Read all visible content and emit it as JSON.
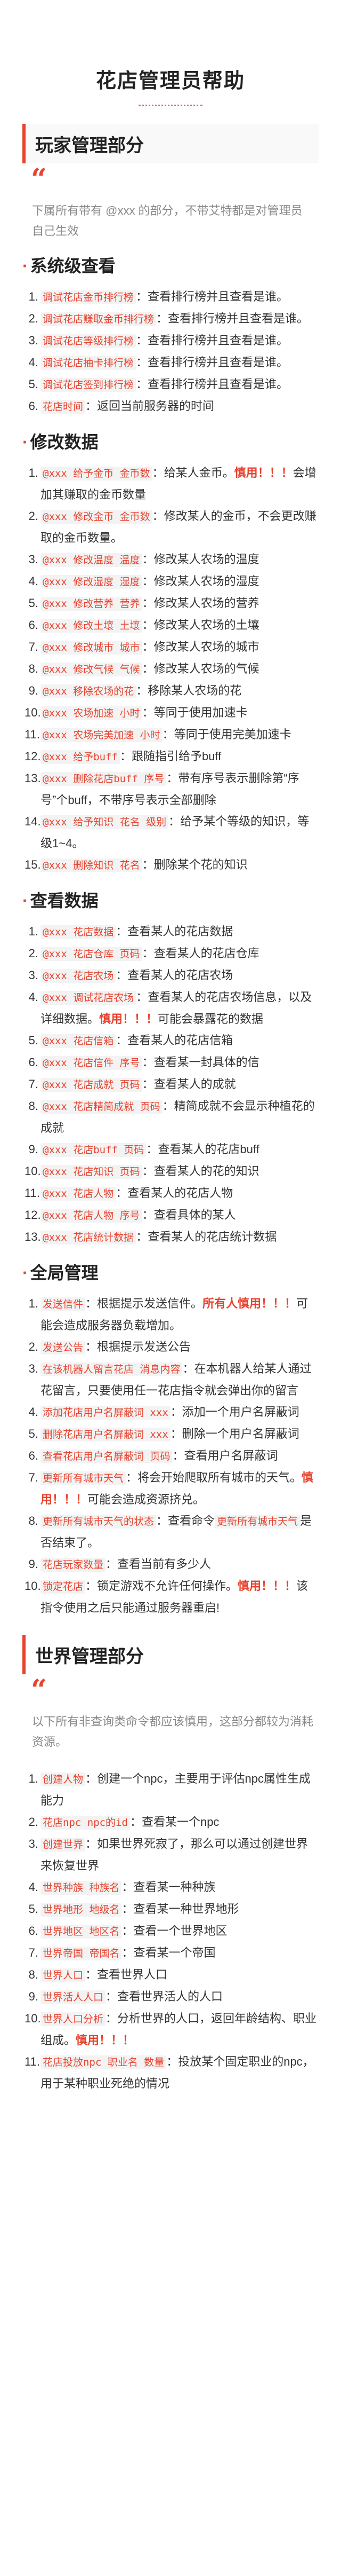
{
  "page_title": "花店管理员帮助",
  "colors": {
    "accent": "#e8432f",
    "text": "#333333",
    "muted": "#888888"
  },
  "sections": [
    {
      "id": "player",
      "title": "玩家管理部分",
      "quote": "下属所有带有 @xxx 的部分，不带艾特都是对管理员自己生效",
      "groups": [
        {
          "heading": "系统级查看",
          "items": [
            [
              [
                "c",
                "调试花店金币排行榜"
              ],
              [
                "t",
                "：查看排行榜并且查看是谁。"
              ]
            ],
            [
              [
                "c",
                "调试花店赚取金币排行榜"
              ],
              [
                "t",
                "：查看排行榜并且查看是谁。"
              ]
            ],
            [
              [
                "c",
                "调试花店等级排行榜"
              ],
              [
                "t",
                "：查看排行榜并且查看是谁。"
              ]
            ],
            [
              [
                "c",
                "调试花店抽卡排行榜"
              ],
              [
                "t",
                "：查看排行榜并且查看是谁。"
              ]
            ],
            [
              [
                "c",
                "调试花店签到排行榜"
              ],
              [
                "t",
                "：查看排行榜并且查看是谁。"
              ]
            ],
            [
              [
                "c",
                "花店时间"
              ],
              [
                "t",
                "：返回当前服务器的时间"
              ]
            ]
          ]
        },
        {
          "heading": "修改数据",
          "items": [
            [
              [
                "c",
                "@xxx 给予金币 金币数"
              ],
              [
                "t",
                "：给某人金币。"
              ],
              [
                "w",
                "慎用！！！"
              ],
              [
                "t",
                "会增加其赚取的金币数量"
              ]
            ],
            [
              [
                "c",
                "@xxx 修改金币 金币数"
              ],
              [
                "t",
                "：修改某人的金币，不会更改赚取的金币数量。"
              ]
            ],
            [
              [
                "c",
                "@xxx 修改温度 温度"
              ],
              [
                "t",
                "：修改某人农场的温度"
              ]
            ],
            [
              [
                "c",
                "@xxx 修改湿度 湿度"
              ],
              [
                "t",
                "：修改某人农场的湿度"
              ]
            ],
            [
              [
                "c",
                "@xxx 修改营养 营养"
              ],
              [
                "t",
                "：修改某人农场的营养"
              ]
            ],
            [
              [
                "c",
                "@xxx 修改土壤 土壤"
              ],
              [
                "t",
                "：修改某人农场的土壤"
              ]
            ],
            [
              [
                "c",
                "@xxx 修改城市 城市"
              ],
              [
                "t",
                "：修改某人农场的城市"
              ]
            ],
            [
              [
                "c",
                "@xxx 修改气候 气候"
              ],
              [
                "t",
                "：修改某人农场的气候"
              ]
            ],
            [
              [
                "c",
                "@xxx 移除农场的花"
              ],
              [
                "t",
                "：移除某人农场的花"
              ]
            ],
            [
              [
                "c",
                "@xxx 农场加速 小时"
              ],
              [
                "t",
                "：等同于使用加速卡"
              ]
            ],
            [
              [
                "c",
                "@xxx 农场完美加速 小时"
              ],
              [
                "t",
                "：等同于使用完美加速卡"
              ]
            ],
            [
              [
                "c",
                "@xxx 给予buff"
              ],
              [
                "t",
                "：跟随指引给予buff"
              ]
            ],
            [
              [
                "c",
                "@xxx 删除花店buff 序号"
              ],
              [
                "t",
                "：带有序号表示删除第“序号”个buff，不带序号表示全部删除"
              ]
            ],
            [
              [
                "c",
                "@xxx 给予知识 花名 级别"
              ],
              [
                "t",
                "：给予某个等级的知识，等级1~4。"
              ]
            ],
            [
              [
                "c",
                "@xxx 删除知识 花名"
              ],
              [
                "t",
                "：删除某个花的知识"
              ]
            ]
          ]
        },
        {
          "heading": "查看数据",
          "items": [
            [
              [
                "c",
                "@xxx 花店数据"
              ],
              [
                "t",
                "：查看某人的花店数据"
              ]
            ],
            [
              [
                "c",
                "@xxx 花店仓库 页码"
              ],
              [
                "t",
                "：查看某人的花店仓库"
              ]
            ],
            [
              [
                "c",
                "@xxx 花店农场"
              ],
              [
                "t",
                "：查看某人的花店农场"
              ]
            ],
            [
              [
                "c",
                "@xxx 调试花店农场"
              ],
              [
                "t",
                "：查看某人的花店农场信息，以及详细数据。"
              ],
              [
                "w",
                "慎用！！！"
              ],
              [
                "t",
                "可能会暴露花的数据"
              ]
            ],
            [
              [
                "c",
                "@xxx 花店信箱"
              ],
              [
                "t",
                "：查看某人的花店信箱"
              ]
            ],
            [
              [
                "c",
                "@xxx 花店信件 序号"
              ],
              [
                "t",
                "：查看某一封具体的信"
              ]
            ],
            [
              [
                "c",
                "@xxx 花店成就 页码"
              ],
              [
                "t",
                "：查看某人的成就"
              ]
            ],
            [
              [
                "c",
                "@xxx 花店精简成就 页码"
              ],
              [
                "t",
                "：精简成就不会显示种植花的成就"
              ]
            ],
            [
              [
                "c",
                "@xxx 花店buff 页码"
              ],
              [
                "t",
                "：查看某人的花店buff"
              ]
            ],
            [
              [
                "c",
                "@xxx 花店知识 页码"
              ],
              [
                "t",
                "：查看某人的花的知识"
              ]
            ],
            [
              [
                "c",
                "@xxx 花店人物"
              ],
              [
                "t",
                "：查看某人的花店人物"
              ]
            ],
            [
              [
                "c",
                "@xxx 花店人物 序号"
              ],
              [
                "t",
                "：查看具体的某人"
              ]
            ],
            [
              [
                "c",
                "@xxx 花店统计数据"
              ],
              [
                "t",
                "：查看某人的花店统计数据"
              ]
            ]
          ]
        },
        {
          "heading": "全局管理",
          "items": [
            [
              [
                "c",
                "发送信件"
              ],
              [
                "t",
                "：根据提示发送信件。"
              ],
              [
                "w",
                "所有人慎用！！！"
              ],
              [
                "t",
                "可能会造成服务器负载增加。"
              ]
            ],
            [
              [
                "c",
                "发送公告"
              ],
              [
                "t",
                "：根据提示发送公告"
              ]
            ],
            [
              [
                "c",
                "在该机器人留言花店 消息内容"
              ],
              [
                "t",
                "：在本机器人给某人通过花留言，只要使用任一花店指令就会弹出你的留言"
              ]
            ],
            [
              [
                "c",
                "添加花店用户名屏蔽词 xxx"
              ],
              [
                "t",
                "：添加一个用户名屏蔽词"
              ]
            ],
            [
              [
                "c",
                "删除花店用户名屏蔽词 xxx"
              ],
              [
                "t",
                "：删除一个用户名屏蔽词"
              ]
            ],
            [
              [
                "c",
                "查看花店用户名屏蔽词 页码"
              ],
              [
                "t",
                "：查看用户名屏蔽词"
              ]
            ],
            [
              [
                "c",
                "更新所有城市天气"
              ],
              [
                "t",
                "：将会开始爬取所有城市的天气。"
              ],
              [
                "w",
                "慎用！！！"
              ],
              [
                "t",
                "可能会造成资源挤兑。"
              ]
            ],
            [
              [
                "c",
                "更新所有城市天气的状态"
              ],
              [
                "t",
                "：查看命令"
              ],
              [
                "c",
                "更新所有城市天气"
              ],
              [
                "t",
                "是否结束了。"
              ]
            ],
            [
              [
                "c",
                "花店玩家数量"
              ],
              [
                "t",
                "：查看当前有多少人"
              ]
            ],
            [
              [
                "c",
                "锁定花店"
              ],
              [
                "t",
                "：锁定游戏不允许任何操作。"
              ],
              [
                "w",
                "慎用！！！"
              ],
              [
                "t",
                "该指令使用之后只能通过服务器重启!"
              ]
            ]
          ]
        }
      ]
    },
    {
      "id": "world",
      "title": "世界管理部分",
      "quote": "以下所有非查询类命令都应该慎用，这部分都较为消耗资源。",
      "groups": [
        {
          "heading": "",
          "items": [
            [
              [
                "c",
                "创建人物"
              ],
              [
                "t",
                "：创建一个npc，主要用于评估npc属性生成能力"
              ]
            ],
            [
              [
                "c",
                "花店npc npc的id"
              ],
              [
                "t",
                "：查看某一个npc"
              ]
            ],
            [
              [
                "c",
                "创建世界"
              ],
              [
                "t",
                "：如果世界死寂了，那么可以通过创建世界来恢复世界"
              ]
            ],
            [
              [
                "c",
                "世界种族 种族名"
              ],
              [
                "t",
                "：查看某一种种族"
              ]
            ],
            [
              [
                "c",
                "世界地形 地级名"
              ],
              [
                "t",
                "：查看某一种世界地形"
              ]
            ],
            [
              [
                "c",
                "世界地区 地区名"
              ],
              [
                "t",
                "：查看一个世界地区"
              ]
            ],
            [
              [
                "c",
                "世界帝国 帝国名"
              ],
              [
                "t",
                "：查看某一个帝国"
              ]
            ],
            [
              [
                "c",
                "世界人口"
              ],
              [
                "t",
                "：查看世界人口"
              ]
            ],
            [
              [
                "c",
                "世界活人人口"
              ],
              [
                "t",
                "：查看世界活人的人口"
              ]
            ],
            [
              [
                "c",
                "世界人口分析"
              ],
              [
                "t",
                "：分析世界的人口，返回年龄结构、职业组成。"
              ],
              [
                "w",
                "慎用！！！"
              ]
            ],
            [
              [
                "c",
                "花店投放npc 职业名 数量"
              ],
              [
                "t",
                "：投放某个固定职业的npc，用于某种职业死绝的情况"
              ]
            ]
          ]
        }
      ]
    }
  ]
}
